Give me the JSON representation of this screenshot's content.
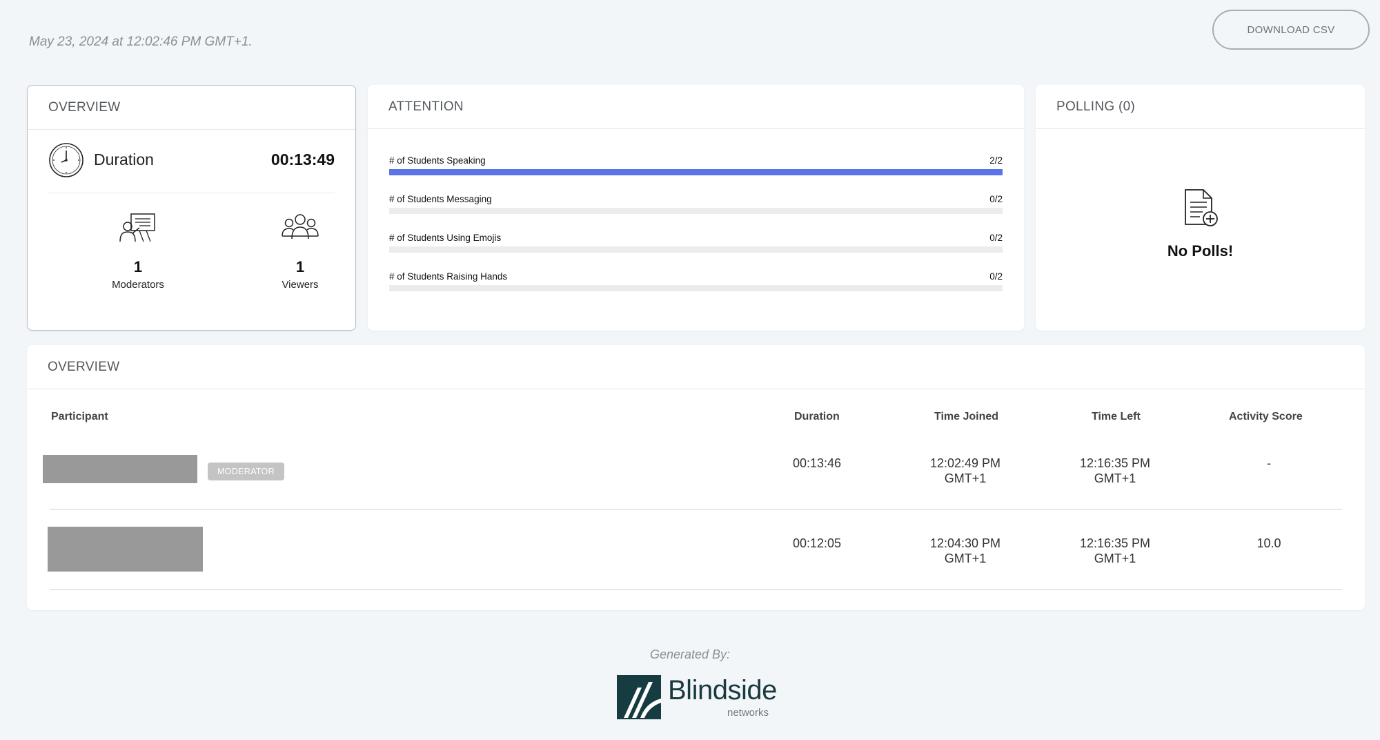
{
  "header": {
    "timestamp": "May 23, 2024 at 12:02:46 PM GMT+1.",
    "download_label": "DOWNLOAD CSV"
  },
  "overview_card": {
    "title": "OVERVIEW",
    "duration_label": "Duration",
    "duration_value": "00:13:49",
    "moderators_count": "1",
    "moderators_label": "Moderators",
    "viewers_count": "1",
    "viewers_label": "Viewers"
  },
  "attention": {
    "title": "ATTENTION",
    "accent_color": "#5b73e8",
    "bars": [
      {
        "label": "# of Students Speaking",
        "value": "2/2",
        "fraction": 1.0
      },
      {
        "label": "# of Students Messaging",
        "value": "0/2",
        "fraction": 0
      },
      {
        "label": "# of Students Using Emojis",
        "value": "0/2",
        "fraction": 0
      },
      {
        "label": "# of Students Raising Hands",
        "value": "0/2",
        "fraction": 0
      }
    ]
  },
  "polling": {
    "title": "POLLING (0)",
    "empty_text": "No Polls!"
  },
  "table": {
    "title": "OVERVIEW",
    "columns": [
      "Participant",
      "Duration",
      "Time Joined",
      "Time Left",
      "Activity Score"
    ],
    "rows": [
      {
        "badge": "MODERATOR",
        "duration": "00:13:46",
        "joined_1": "12:02:49 PM",
        "joined_2": "GMT+1",
        "left_1": "12:16:35 PM",
        "left_2": "GMT+1",
        "score": "-"
      },
      {
        "badge": "",
        "duration": "00:12:05",
        "joined_1": "12:04:30 PM",
        "joined_2": "GMT+1",
        "left_1": "12:16:35 PM",
        "left_2": "GMT+1",
        "score": "10.0"
      }
    ]
  },
  "footer": {
    "generated_by": "Generated By:",
    "logo_name": "Blindside",
    "logo_sub": "networks"
  }
}
